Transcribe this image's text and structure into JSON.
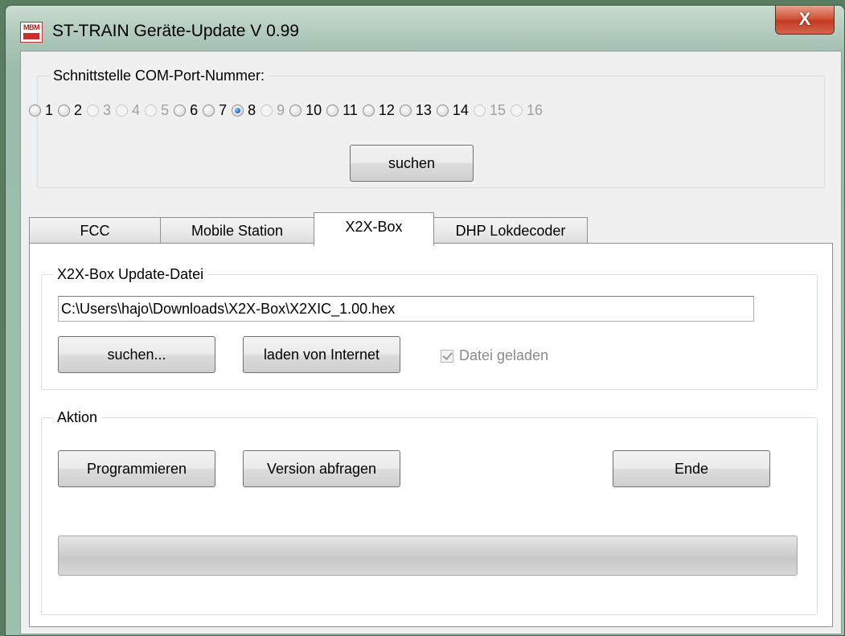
{
  "window": {
    "title": "ST-TRAIN Geräte-Update  V 0.99",
    "icon_text": "MBM",
    "close_label": "X"
  },
  "com_port": {
    "legend": "Schnittstelle COM-Port-Nummer:",
    "ports": [
      {
        "label": "1",
        "enabled": true,
        "selected": false
      },
      {
        "label": "2",
        "enabled": true,
        "selected": false
      },
      {
        "label": "3",
        "enabled": false,
        "selected": false
      },
      {
        "label": "4",
        "enabled": false,
        "selected": false
      },
      {
        "label": "5",
        "enabled": false,
        "selected": false
      },
      {
        "label": "6",
        "enabled": true,
        "selected": false
      },
      {
        "label": "7",
        "enabled": true,
        "selected": false
      },
      {
        "label": "8",
        "enabled": true,
        "selected": true
      },
      {
        "label": "9",
        "enabled": false,
        "selected": false
      },
      {
        "label": "10",
        "enabled": true,
        "selected": false
      },
      {
        "label": "11",
        "enabled": true,
        "selected": false
      },
      {
        "label": "12",
        "enabled": true,
        "selected": false
      },
      {
        "label": "13",
        "enabled": true,
        "selected": false
      },
      {
        "label": "14",
        "enabled": true,
        "selected": false
      },
      {
        "label": "15",
        "enabled": false,
        "selected": false
      },
      {
        "label": "16",
        "enabled": false,
        "selected": false
      }
    ],
    "search_button": "suchen"
  },
  "tabs": [
    {
      "label": "FCC",
      "active": false
    },
    {
      "label": "Mobile Station",
      "active": false
    },
    {
      "label": "X2X-Box",
      "active": true
    },
    {
      "label": "DHP Lokdecoder",
      "active": false
    }
  ],
  "update_file": {
    "legend": "X2X-Box Update-Datei",
    "path_value": "C:\\Users\\hajo\\Downloads\\X2X-Box\\X2XIC_1.00.hex",
    "browse_button": "suchen...",
    "download_button": "laden von Internet",
    "loaded_checkbox": "Datei geladen",
    "loaded_checked": true
  },
  "action": {
    "legend": "Aktion",
    "program_button": "Programmieren",
    "version_button": "Version abfragen",
    "exit_button": "Ende",
    "progress": 0
  }
}
